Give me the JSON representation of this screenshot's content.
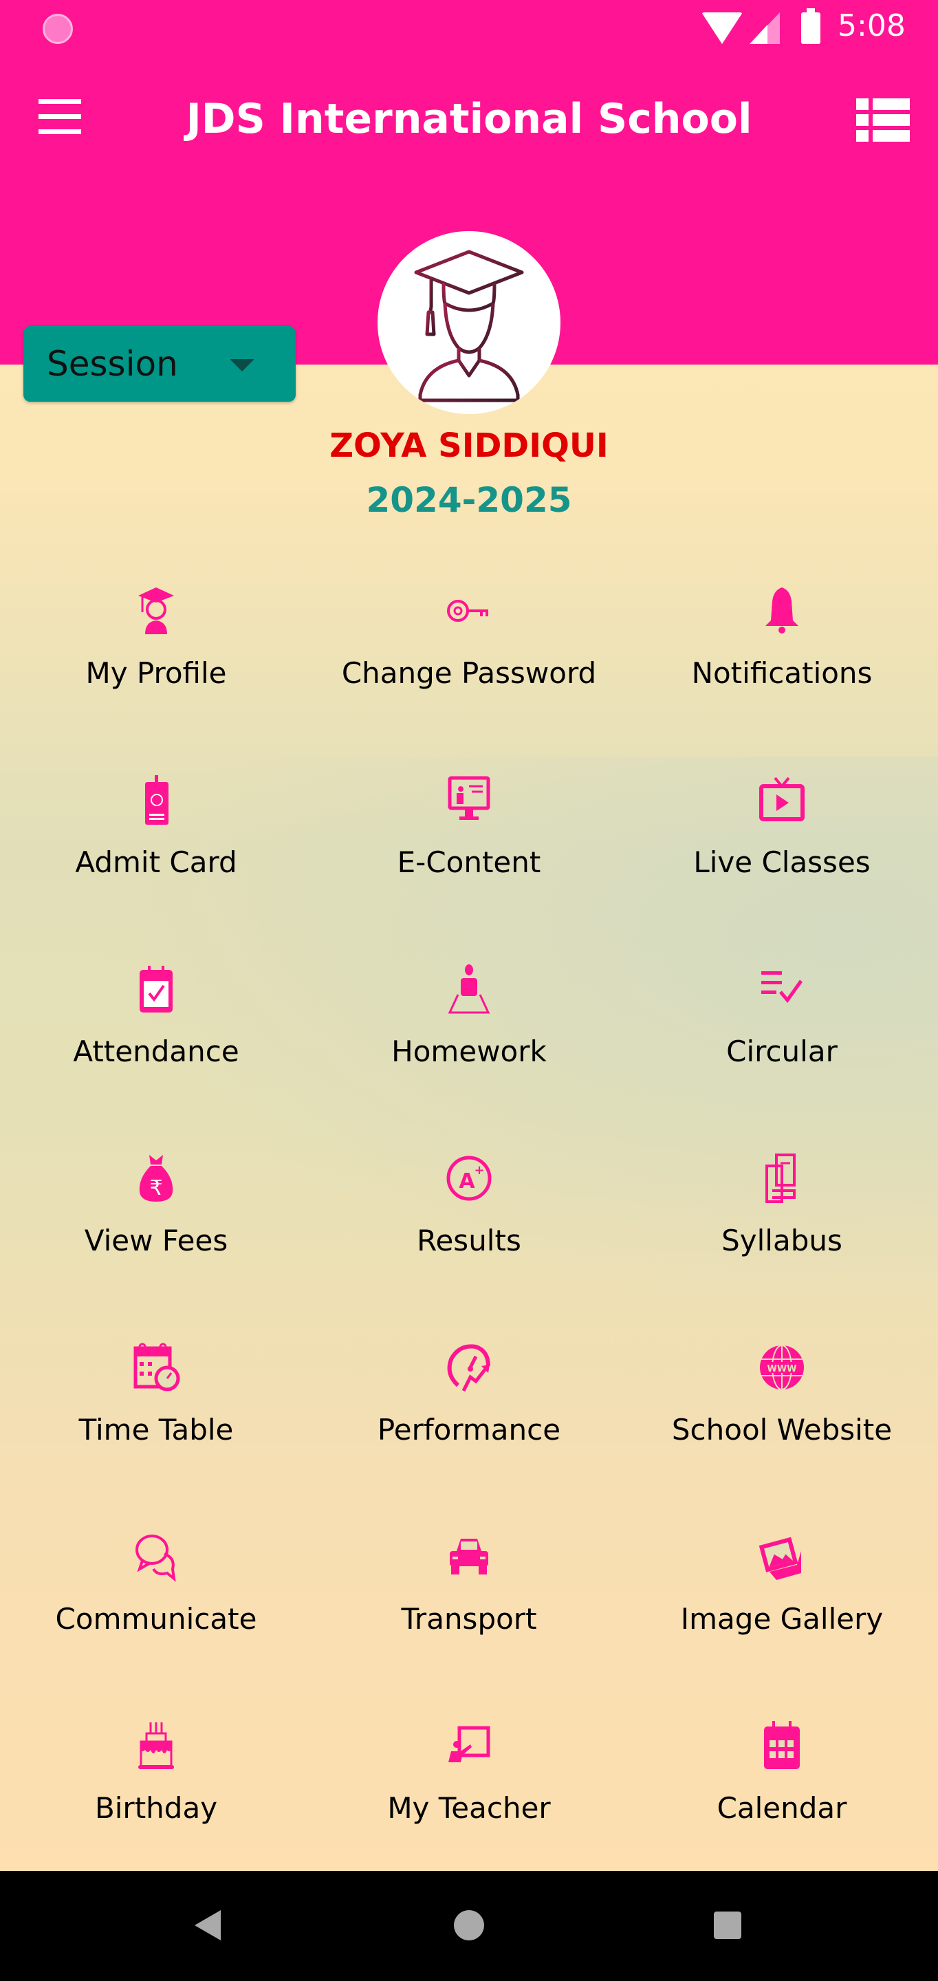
{
  "status_bar": {
    "time": "5:08",
    "icons": [
      "app-notification-icon",
      "wifi-icon",
      "signal-icon",
      "battery-icon"
    ]
  },
  "header": {
    "title": "JDS International School",
    "menu_icon": "hamburger-menu-icon",
    "right_icon": "list-view-icon"
  },
  "session_dropdown": {
    "label": "Session"
  },
  "profile": {
    "name": "ZOYA SIDDIQUI",
    "session_year": "2024-2025",
    "avatar_icon": "graduate-avatar-icon"
  },
  "colors": {
    "brand_pink": "#ff1493",
    "teal": "#009688",
    "name_red": "#e00000",
    "year_teal": "#16948a"
  },
  "menu": [
    {
      "label": "My Profile",
      "icon": "graduate-icon"
    },
    {
      "label": "Change Password",
      "icon": "key-icon"
    },
    {
      "label": "Notifications",
      "icon": "bell-icon"
    },
    {
      "label": "Admit Card",
      "icon": "id-card-icon"
    },
    {
      "label": "E-Content",
      "icon": "monitor-teacher-icon"
    },
    {
      "label": "Live Classes",
      "icon": "tv-play-icon"
    },
    {
      "label": "Attendance",
      "icon": "calendar-check-icon"
    },
    {
      "label": "Homework",
      "icon": "reading-student-icon"
    },
    {
      "label": "Circular",
      "icon": "list-check-icon"
    },
    {
      "label": "View Fees",
      "icon": "money-bag-rupee-icon"
    },
    {
      "label": "Results",
      "icon": "grade-a-plus-icon"
    },
    {
      "label": "Syllabus",
      "icon": "books-icon"
    },
    {
      "label": "Time Table",
      "icon": "calendar-clock-icon"
    },
    {
      "label": "Performance",
      "icon": "speedometer-growth-icon"
    },
    {
      "label": "School Website",
      "icon": "globe-www-icon"
    },
    {
      "label": "Communicate",
      "icon": "chat-bubbles-icon"
    },
    {
      "label": "Transport",
      "icon": "car-icon"
    },
    {
      "label": "Image Gallery",
      "icon": "photos-icon"
    },
    {
      "label": "Birthday",
      "icon": "birthday-cake-icon"
    },
    {
      "label": "My Teacher",
      "icon": "teacher-board-icon"
    },
    {
      "label": "Calendar",
      "icon": "calendar-grid-icon"
    }
  ],
  "nav_bar": {
    "buttons": [
      "back-icon",
      "home-icon",
      "recents-icon"
    ]
  }
}
